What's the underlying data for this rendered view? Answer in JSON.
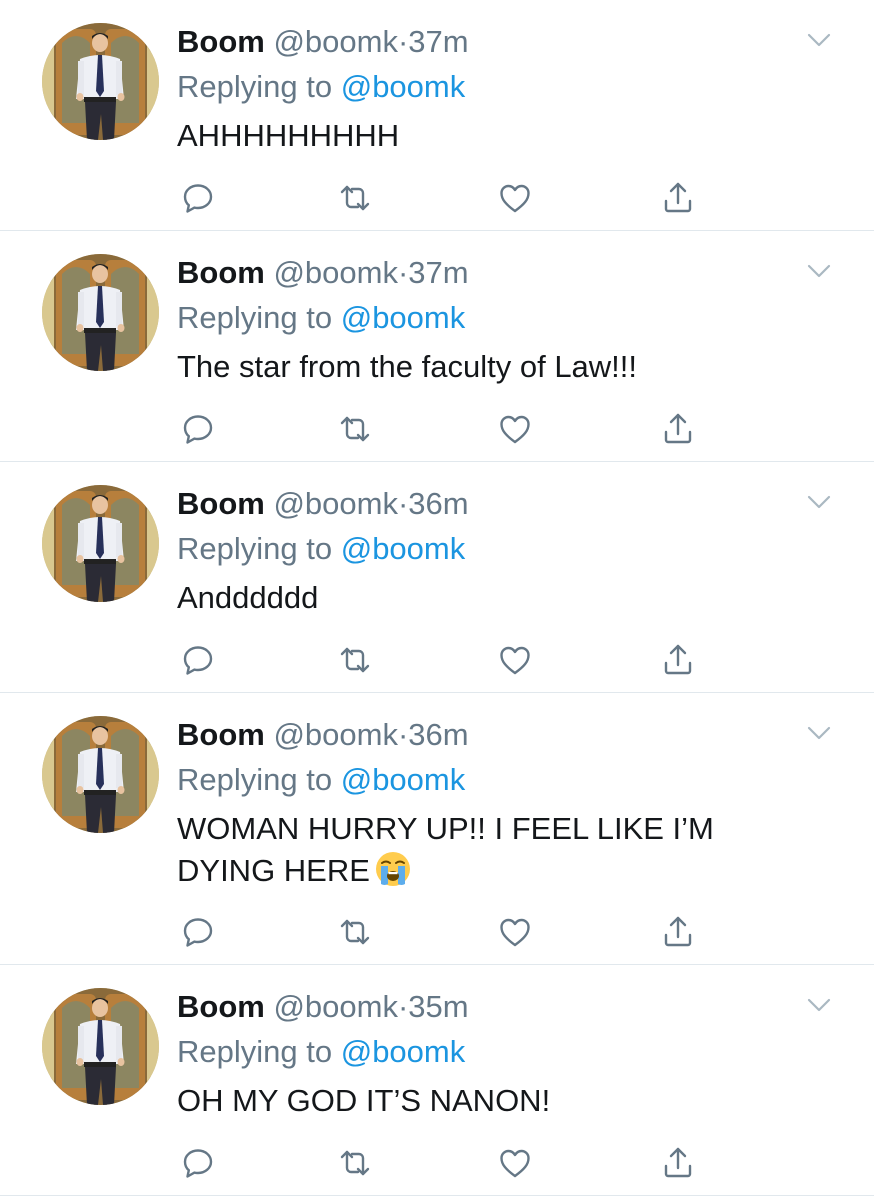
{
  "colors": {
    "text_primary": "#14171a",
    "text_secondary": "#657786",
    "link": "#1b95e0",
    "divider": "#e1e8ed",
    "icon": "#657786"
  },
  "icons": {
    "reply": "speech-bubble-icon",
    "retweet": "retweet-icon",
    "like": "heart-icon",
    "share": "share-icon",
    "menu": "chevron-down-icon"
  },
  "tweets": [
    {
      "name": "Boom",
      "handle": "@boomk",
      "separator": "·",
      "time": "37m",
      "replying_prefix": "Replying to",
      "replying_handle": "@boomk",
      "text": "AHHHHHHHHH",
      "emoji": ""
    },
    {
      "name": "Boom",
      "handle": "@boomk",
      "separator": "·",
      "time": "37m",
      "replying_prefix": "Replying to",
      "replying_handle": "@boomk",
      "text": "The star from the faculty of Law!!!",
      "emoji": ""
    },
    {
      "name": "Boom",
      "handle": "@boomk",
      "separator": "·",
      "time": "36m",
      "replying_prefix": "Replying to",
      "replying_handle": "@boomk",
      "text": "Andddddd",
      "emoji": ""
    },
    {
      "name": "Boom",
      "handle": "@boomk",
      "separator": "·",
      "time": "36m",
      "replying_prefix": "Replying to",
      "replying_handle": "@boomk",
      "text": "WOMAN HURRY UP!! I FEEL LIKE I’M\nDYING HERE",
      "emoji": "loudly-crying-face-emoji"
    },
    {
      "name": "Boom",
      "handle": "@boomk",
      "separator": "·",
      "time": "35m",
      "replying_prefix": "Replying to",
      "replying_handle": "@boomk",
      "text": "OH MY GOD IT’S NANON!",
      "emoji": ""
    }
  ]
}
